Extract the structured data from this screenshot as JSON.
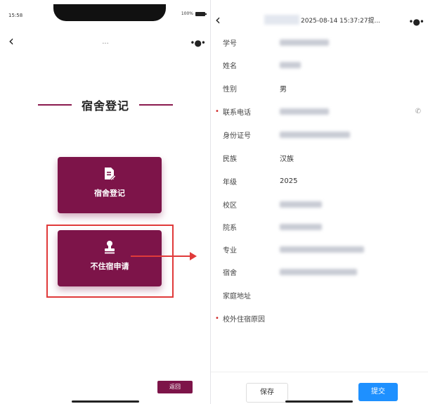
{
  "left": {
    "status_time": "15:58",
    "battery_text": "100%",
    "nav_title": "...",
    "heading": "宿舍登记",
    "tiles": [
      {
        "label": "宿舍登记",
        "icon": "document-edit-icon"
      },
      {
        "label": "不住宿申请",
        "icon": "stamp-icon"
      }
    ],
    "return_label": "返回"
  },
  "right": {
    "title_suffix": "2025-08-14 15:37:27提...",
    "fields": [
      {
        "label": "学号",
        "value": "",
        "required": false
      },
      {
        "label": "姓名",
        "value": "",
        "required": false
      },
      {
        "label": "性别",
        "value": "男",
        "required": false
      },
      {
        "label": "联系电话",
        "value": "",
        "required": true
      },
      {
        "label": "身份证号",
        "value": "",
        "required": false
      },
      {
        "label": "民族",
        "value": "汉族",
        "required": false
      },
      {
        "label": "年级",
        "value": "2025",
        "required": false
      },
      {
        "label": "校区",
        "value": "",
        "required": false
      },
      {
        "label": "院系",
        "value": "",
        "required": false
      },
      {
        "label": "专业",
        "value": "",
        "required": false
      },
      {
        "label": "宿舍",
        "value": "",
        "required": false
      },
      {
        "label": "家庭地址",
        "value": "",
        "required": false
      },
      {
        "label": "校外住宿原因",
        "value": "",
        "required": true
      }
    ],
    "required_mark": "•",
    "save_label": "保存",
    "submit_label": "提交"
  },
  "colors": {
    "brand": "#7d1449",
    "highlight": "#e03a3a",
    "primary": "#1e90ff"
  }
}
